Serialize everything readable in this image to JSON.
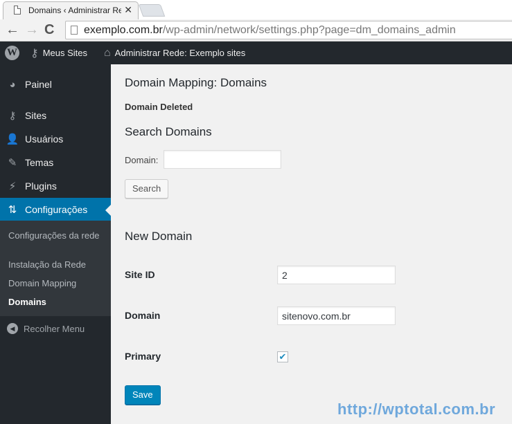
{
  "browser": {
    "tab_title": "Domains ‹ Administrar Re",
    "tab_close": "✕",
    "url_host": "exemplo.com.br",
    "url_path": "/wp-admin/network/settings.php?page=dm_domains_admin",
    "icons": {
      "back": "←",
      "forward": "→",
      "reload": "C"
    }
  },
  "adminbar": {
    "logo": "W",
    "my_sites_icon": "key-icon",
    "my_sites": "Meus Sites",
    "network_icon": "home-icon",
    "network_admin": "Administrar Rede: Exemplo sites"
  },
  "sidebar": {
    "items": [
      {
        "label": "Painel",
        "icon": "dashboard-icon",
        "glyph": "◕"
      },
      {
        "label": "Sites",
        "icon": "key-icon",
        "glyph": "⚷"
      },
      {
        "label": "Usuários",
        "icon": "user-icon",
        "glyph": "👤"
      },
      {
        "label": "Temas",
        "icon": "brush-icon",
        "glyph": "✎"
      },
      {
        "label": "Plugins",
        "icon": "plugin-icon",
        "glyph": "⚡"
      },
      {
        "label": "Configurações",
        "icon": "settings-icon",
        "glyph": "⇅",
        "current": true
      }
    ],
    "submenu": [
      {
        "label": "Configurações da rede"
      },
      {
        "label": "Instalação da Rede"
      },
      {
        "label": "Domain Mapping"
      },
      {
        "label": "Domains",
        "active": true
      }
    ],
    "collapse_label": "Recolher Menu",
    "collapse_glyph": "◀"
  },
  "main": {
    "title": "Domain Mapping: Domains",
    "notice": "Domain Deleted",
    "search_heading": "Search Domains",
    "search_label": "Domain:",
    "search_value": "",
    "search_button": "Search",
    "new_heading": "New Domain",
    "fields": {
      "site_id_label": "Site ID",
      "site_id_value": "2",
      "domain_label": "Domain",
      "domain_value": "sitenovo.com.br",
      "primary_label": "Primary",
      "primary_checked": true,
      "check_glyph": "✔"
    },
    "save_button": "Save"
  },
  "watermark": "http://wptotal.com.br",
  "colors": {
    "accent": "#0073aa",
    "primary_button": "#0085ba",
    "sidebar_bg": "#23282d",
    "submenu_bg": "#32373c",
    "watermark": "#6fa8dc"
  }
}
